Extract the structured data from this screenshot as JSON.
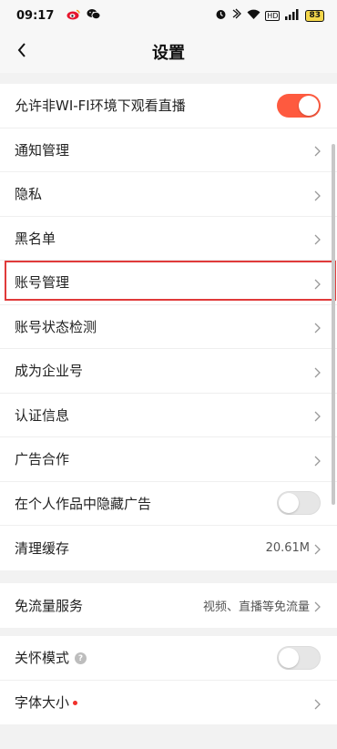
{
  "status_bar": {
    "time": "09:17",
    "left_icons": [
      "weibo-icon",
      "wechat-icon"
    ],
    "right_icons": [
      "alarm-icon",
      "nfc-icon",
      "wifi-icon",
      "hd-icon",
      "signal-icon"
    ],
    "hd_label": "HD",
    "battery": "83"
  },
  "header": {
    "back_icon": "chevron-left-icon",
    "title": "设置"
  },
  "groups": [
    {
      "rows": [
        {
          "label": "允许非WI-FI环境下观看直播",
          "control": "toggle",
          "toggle_on": true
        },
        {
          "label": "通知管理",
          "control": "chevron"
        },
        {
          "label": "隐私",
          "control": "chevron"
        },
        {
          "label": "黑名单",
          "control": "chevron"
        },
        {
          "label": "账号管理",
          "control": "chevron",
          "highlighted": true
        },
        {
          "label": "账号状态检测",
          "control": "chevron"
        },
        {
          "label": "成为企业号",
          "control": "chevron"
        },
        {
          "label": "认证信息",
          "control": "chevron"
        },
        {
          "label": "广告合作",
          "control": "chevron"
        },
        {
          "label": "在个人作品中隐藏广告",
          "control": "toggle",
          "toggle_on": false
        },
        {
          "label": "清理缓存",
          "control": "chevron",
          "value": "20.61M"
        }
      ]
    },
    {
      "rows": [
        {
          "label": "免流量服务",
          "control": "chevron",
          "value": "视频、直播等免流量"
        }
      ]
    },
    {
      "rows": [
        {
          "label": "关怀模式",
          "control": "toggle",
          "toggle_on": false,
          "help_icon": true
        },
        {
          "label": "字体大小",
          "control": "chevron",
          "red_dot": true
        }
      ]
    }
  ],
  "colors": {
    "toggle_on": "#fe5a3f",
    "toggle_off": "#e6e6e6",
    "highlight_border": "#e03a3a",
    "red_dot": "#f0302b",
    "background": "#f2f2f2"
  }
}
